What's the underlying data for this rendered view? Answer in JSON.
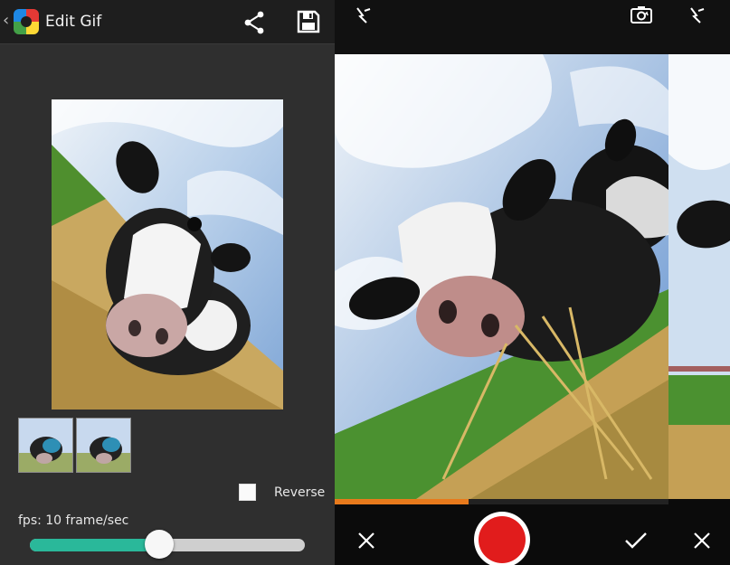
{
  "header": {
    "back_icon": "chevron-left-icon",
    "app_icon": "gif-app-icon",
    "title": "Edit Gif",
    "share_icon": "share-icon",
    "save_icon": "save-floppy-icon"
  },
  "editor": {
    "preview": "cow-photo",
    "thumbnails": [
      "frame-1",
      "frame-2"
    ],
    "reverse_label": "Reverse",
    "reverse_checked": false,
    "fps_label": "fps: 10 frame/sec",
    "fps_fraction": 0.47
  },
  "camera": {
    "flash_icon": "flash-auto-icon",
    "switch_icon": "switch-camera-icon",
    "cancel_icon": "close-icon",
    "record_icon": "record-icon",
    "confirm_icon": "check-icon",
    "progress_fraction": 0.4
  },
  "camera2": {
    "flash_icon": "flash-auto-icon",
    "cancel_icon": "close-icon"
  },
  "colors": {
    "accent": "#2ab89a",
    "record": "#e11c1c",
    "progress": "#e87a1c"
  }
}
